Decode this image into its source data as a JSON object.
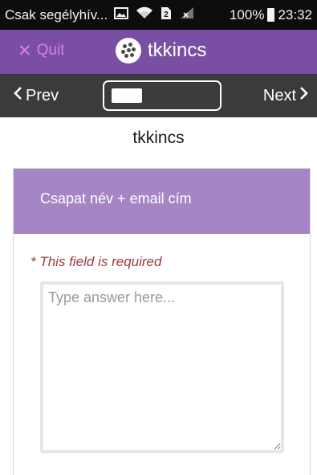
{
  "status_bar": {
    "carrier": "Csak segélyhív...",
    "battery": "100%",
    "time": "23:32",
    "icons": [
      "image-icon",
      "wifi-icon",
      "sim-icon",
      "no-signal-icon",
      "battery-icon"
    ]
  },
  "header": {
    "quit_label": "Quit",
    "app_name": "tkkincs",
    "quit_color": "#d87ef1",
    "bar_color": "#7a4fa3"
  },
  "nav": {
    "prev_label": "Prev",
    "next_label": "Next",
    "progress_fraction": 0.3
  },
  "page": {
    "title": "tkkincs"
  },
  "question": {
    "label": "Csapat név + email cím",
    "required_text": "* This field is required",
    "answer_placeholder": "Type answer here...",
    "answer_value": "",
    "header_color": "#a585c4"
  }
}
